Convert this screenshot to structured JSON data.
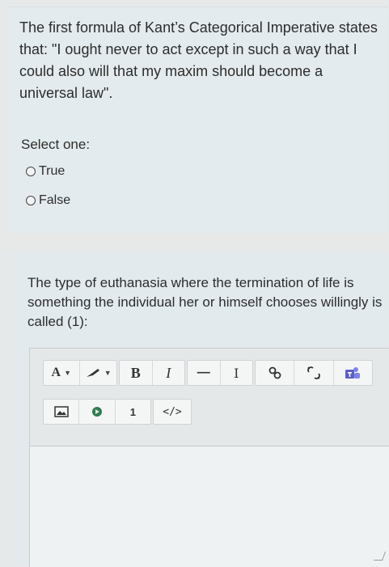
{
  "question1": {
    "text": "The first formula of Kant’s Categorical Imperative states that: \"I ought never to act except in such a way that I could also will that my maxim should become a universal law\".",
    "select_label": "Select one:",
    "options": [
      {
        "label": "True",
        "selected": false
      },
      {
        "label": "False",
        "selected": false
      }
    ]
  },
  "question2": {
    "text": "The type of euthanasia where the termination of life is something the individual her or himself chooses willingly is called (1):"
  },
  "editor": {
    "toolbar": {
      "font_color_label": "A",
      "bold_label": "B",
      "italic_label": "I",
      "hr_label": "—",
      "clear_format_label": "I",
      "html_label": "</>",
      "special_label": "1"
    },
    "icons": [
      "font-color-icon",
      "highlight-icon",
      "bold-icon",
      "italic-icon",
      "horizontal-rule-icon",
      "clear-format-icon",
      "link-icon",
      "unlink-icon",
      "teams-icon",
      "image-icon",
      "media-icon",
      "special-char-icon",
      "html-icon"
    ],
    "colors": {
      "teams": "#5b5fc7",
      "text": "#2d2d2d"
    }
  }
}
